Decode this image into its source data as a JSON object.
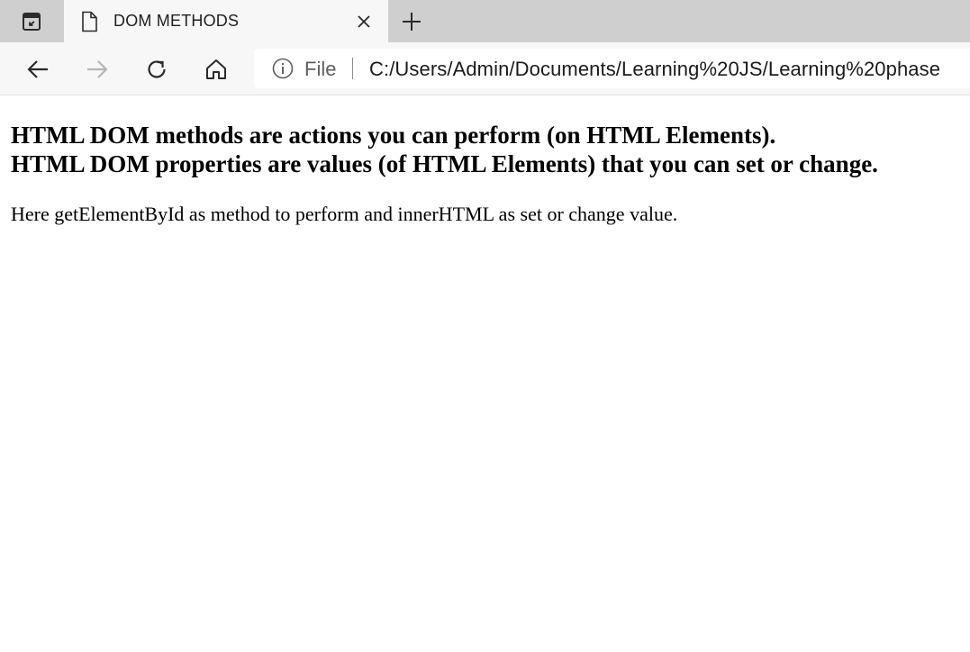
{
  "browser": {
    "tab": {
      "title": "DOM METHODS",
      "page_icon": "page-icon",
      "close_icon": "close-icon"
    },
    "tab_actions_icon": "tab-actions-icon",
    "new_tab_icon": "plus-icon",
    "nav": {
      "back_icon": "back-arrow-icon",
      "forward_icon": "forward-arrow-icon",
      "forward_enabled": false,
      "refresh_icon": "refresh-icon",
      "home_icon": "home-icon"
    },
    "address_bar": {
      "info_icon": "info-icon",
      "scheme_label": "File",
      "url": "C:/Users/Admin/Documents/Learning%20JS/Learning%20phase"
    }
  },
  "page": {
    "heading_line1": "HTML DOM methods are actions you can perform (on HTML Elements).",
    "heading_line2": "HTML DOM properties are values (of HTML Elements) that you can set or change.",
    "paragraph": "Here getElementById as method to perform and innerHTML as set or change value."
  },
  "colors": {
    "tabstrip_bg": "#cfcfcf",
    "toolbar_bg": "#f7f7f7",
    "icon": "#2b2b2b",
    "icon_disabled": "#b5b5b5"
  }
}
